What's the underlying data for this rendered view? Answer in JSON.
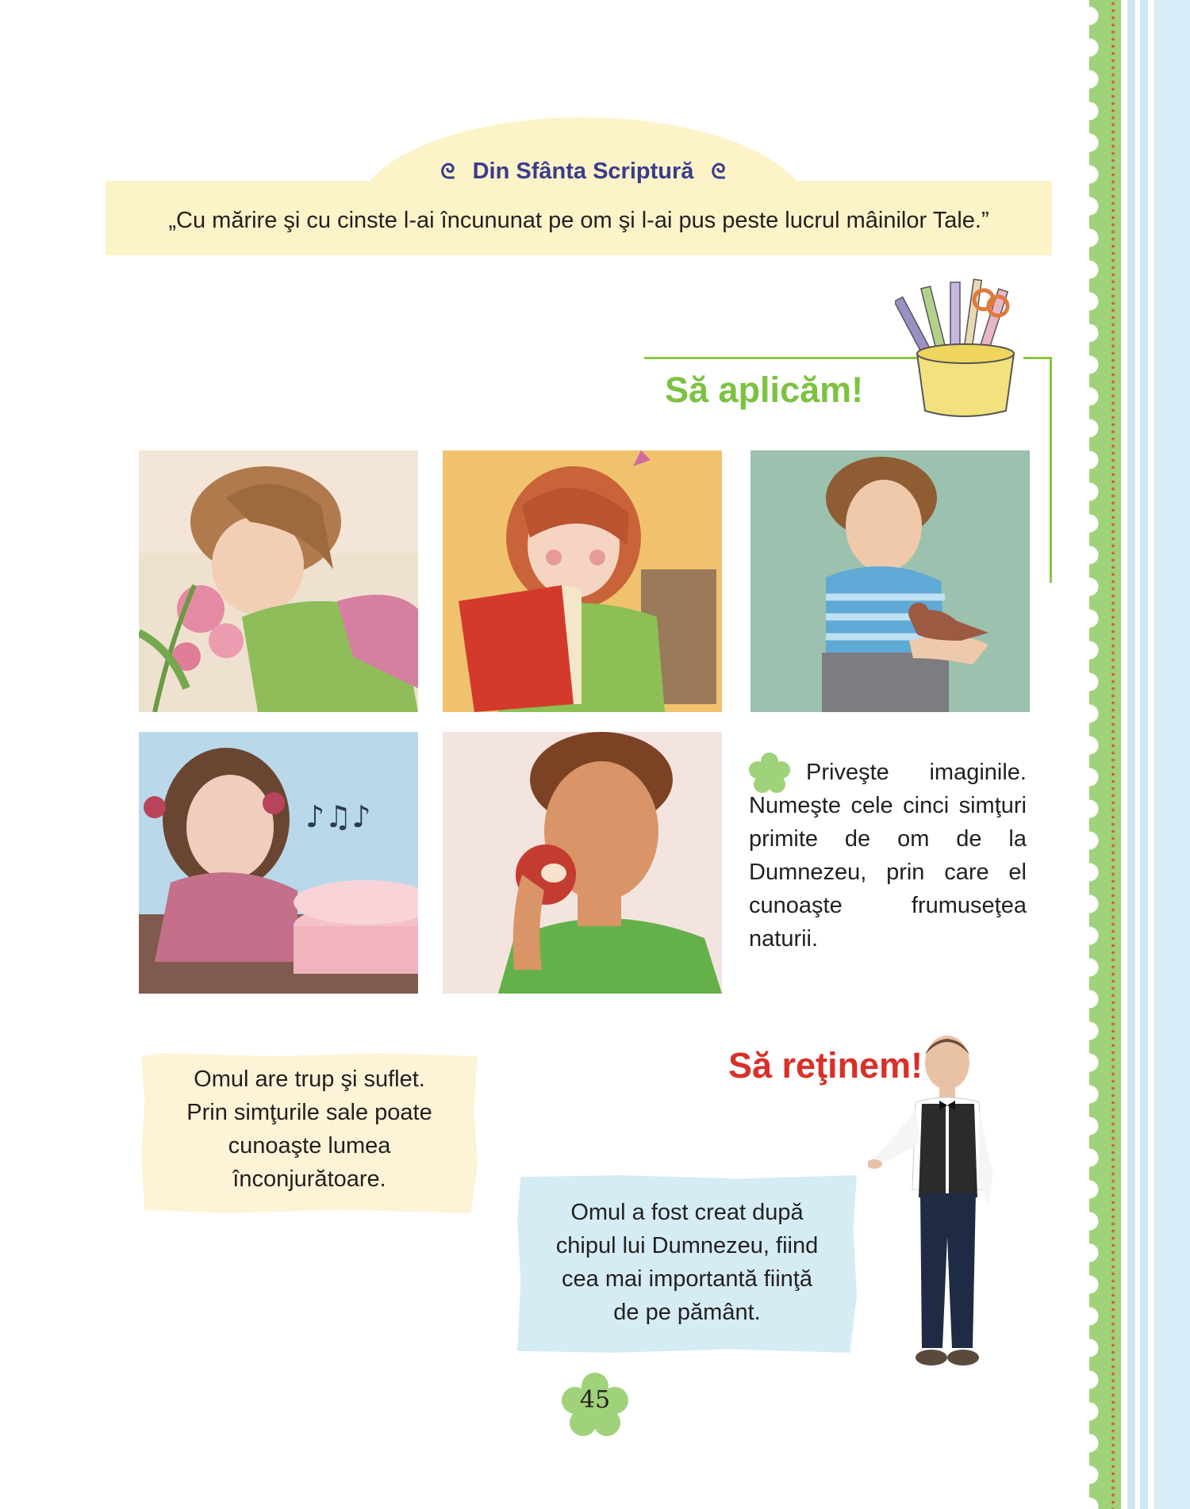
{
  "scripture": {
    "title": "Din Sfânta Scriptură",
    "quote": "„Cu mărire şi cu cinste l-ai încununat pe om şi l-ai pus peste lucrul mâinilor Tale.”"
  },
  "apply": {
    "heading": "Să aplicăm!",
    "instruction": "Priveşte imaginile. Numeşte cele cinci simţuri primite de om de la Dumnezeu, prin care el cunoaşte frumuseţea naturii."
  },
  "remember": {
    "heading": "Să reţinem!",
    "note_1": [
      "Omul are trup şi suflet.",
      "Prin simţurile sale poate",
      "cunoaşte lumea",
      "înconjurătoare."
    ],
    "note_2": [
      "Omul a fost creat după",
      "chipul lui Dumnezeu, fiind",
      "cea mai importantă fiinţă",
      "de pe pământ."
    ]
  },
  "page_number": "45",
  "colors": {
    "accent_green": "#7cc242",
    "accent_red": "#d9302a",
    "banner_title": "#3a3c8e",
    "banner_bg": "#fdf3c8",
    "note_yellow": "#fdf3d7",
    "note_blue": "#d6ecf5"
  },
  "icons": [
    "ornament-swirl-icon",
    "pencil-cup-icon",
    "green-flower-icon"
  ]
}
